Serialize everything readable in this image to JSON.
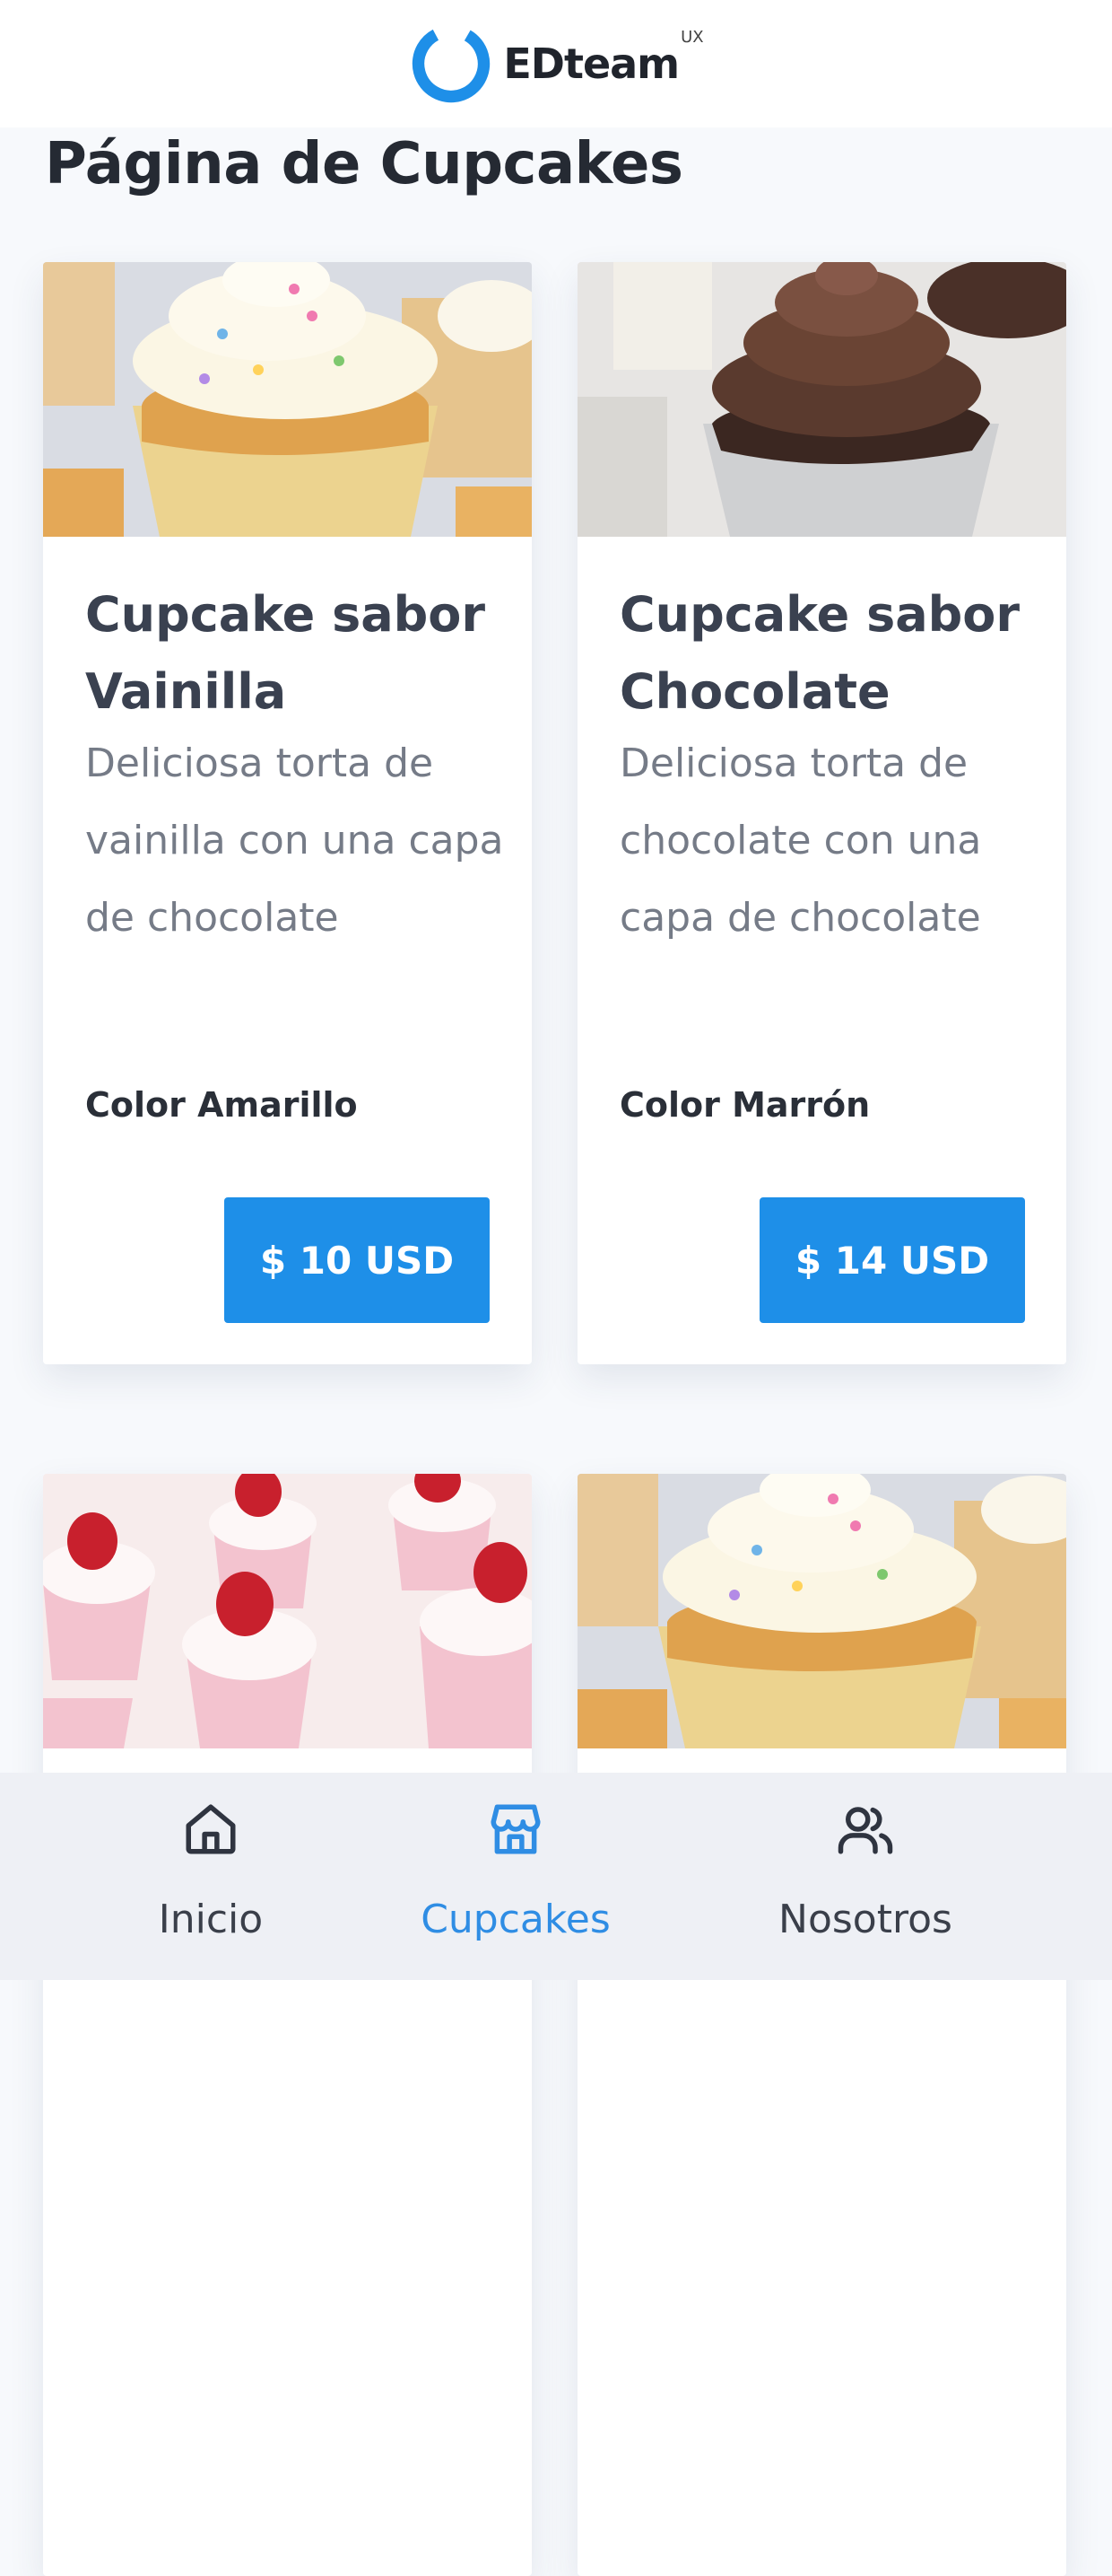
{
  "header": {
    "logo_text": "EDteam",
    "logo_superscript": "UX"
  },
  "page_title": "Página de Cupcakes",
  "products": [
    {
      "title_line1": "Cupcake sabor",
      "title_line2": "Vainilla",
      "desc_line1": "Deliciosa torta de",
      "desc_line2": "vainilla con una capa",
      "desc_line3": "de chocolate",
      "color": "Color Amarillo",
      "price": "$ 10 USD",
      "image": "vanilla-cupcake-image"
    },
    {
      "title_line1": "Cupcake sabor",
      "title_line2": "Chocolate",
      "desc_line1": "Deliciosa torta de",
      "desc_line2": "chocolate con una",
      "desc_line3": "capa de chocolate",
      "color": "Color Marrón",
      "price": "$ 14 USD",
      "image": "chocolate-cupcake-image"
    },
    {
      "image": "strawberry-cupcakes-image"
    },
    {
      "image": "vanilla-cupcake-image"
    }
  ],
  "nav": {
    "items": [
      {
        "label": "Inicio",
        "icon": "home-icon",
        "active": false
      },
      {
        "label": "Cupcakes",
        "icon": "store-icon",
        "active": true
      },
      {
        "label": "Nosotros",
        "icon": "users-icon",
        "active": false
      }
    ]
  },
  "colors": {
    "accent": "#1e8fe8",
    "nav_active": "#2f8de4",
    "page_background": "#f7f9fc"
  }
}
